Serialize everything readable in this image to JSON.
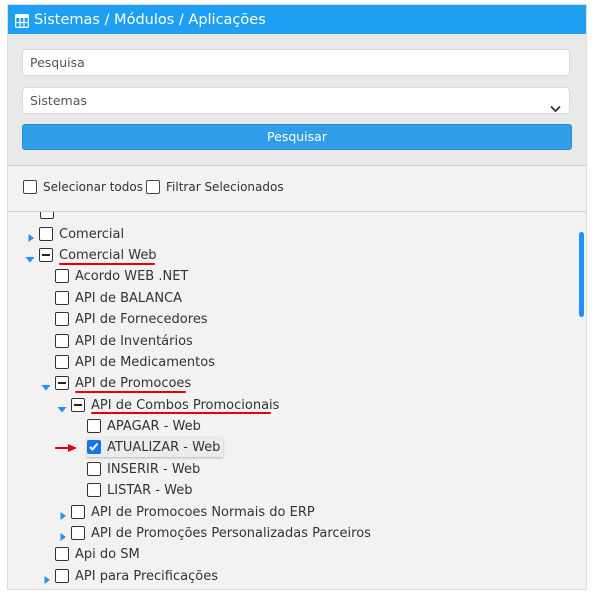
{
  "header": {
    "title": "Sistemas / Módulos / Aplicações",
    "icon": "grid-window-icon",
    "color": "#1e9ff2"
  },
  "filters": {
    "search_placeholder": "Pesquisa",
    "system_select_value": "Sistemas",
    "search_button": "Pesquisar"
  },
  "checks": {
    "select_all": "Selecionar todos",
    "filter_selected": "Filtrar Selecionados"
  },
  "tree": {
    "nodes": [
      {
        "label": "Comercial",
        "state": "unchecked",
        "expand": "collapsed"
      },
      {
        "label": "Comercial Web",
        "state": "partial",
        "expand": "expanded"
      },
      {
        "label": "Acordo WEB .NET",
        "state": "unchecked"
      },
      {
        "label": "API de BALANCA",
        "state": "unchecked"
      },
      {
        "label": "API de Fornecedores",
        "state": "unchecked"
      },
      {
        "label": "API de Inventários",
        "state": "unchecked"
      },
      {
        "label": "API de Medicamentos",
        "state": "unchecked"
      },
      {
        "label": "API de Promocoes",
        "state": "partial",
        "expand": "expanded"
      },
      {
        "label": "API de Combos Promocionais",
        "state": "partial",
        "expand": "expanded"
      },
      {
        "label": "APAGAR - Web",
        "state": "unchecked"
      },
      {
        "label": "ATUALIZAR - Web",
        "state": "checked"
      },
      {
        "label": "INSERIR - Web",
        "state": "unchecked"
      },
      {
        "label": "LISTAR - Web",
        "state": "unchecked"
      },
      {
        "label": "API de Promocoes Normais do ERP",
        "state": "unchecked",
        "expand": "collapsed"
      },
      {
        "label": "API de Promoções Personalizadas Parceiros",
        "state": "unchecked",
        "expand": "collapsed"
      },
      {
        "label": "Api do SM",
        "state": "unchecked"
      },
      {
        "label": "API para Precificações",
        "state": "unchecked",
        "expand": "collapsed"
      }
    ]
  },
  "colors": {
    "accent": "#1e9ff2",
    "annotation": "#e60012",
    "checked": "#1a73e8"
  }
}
